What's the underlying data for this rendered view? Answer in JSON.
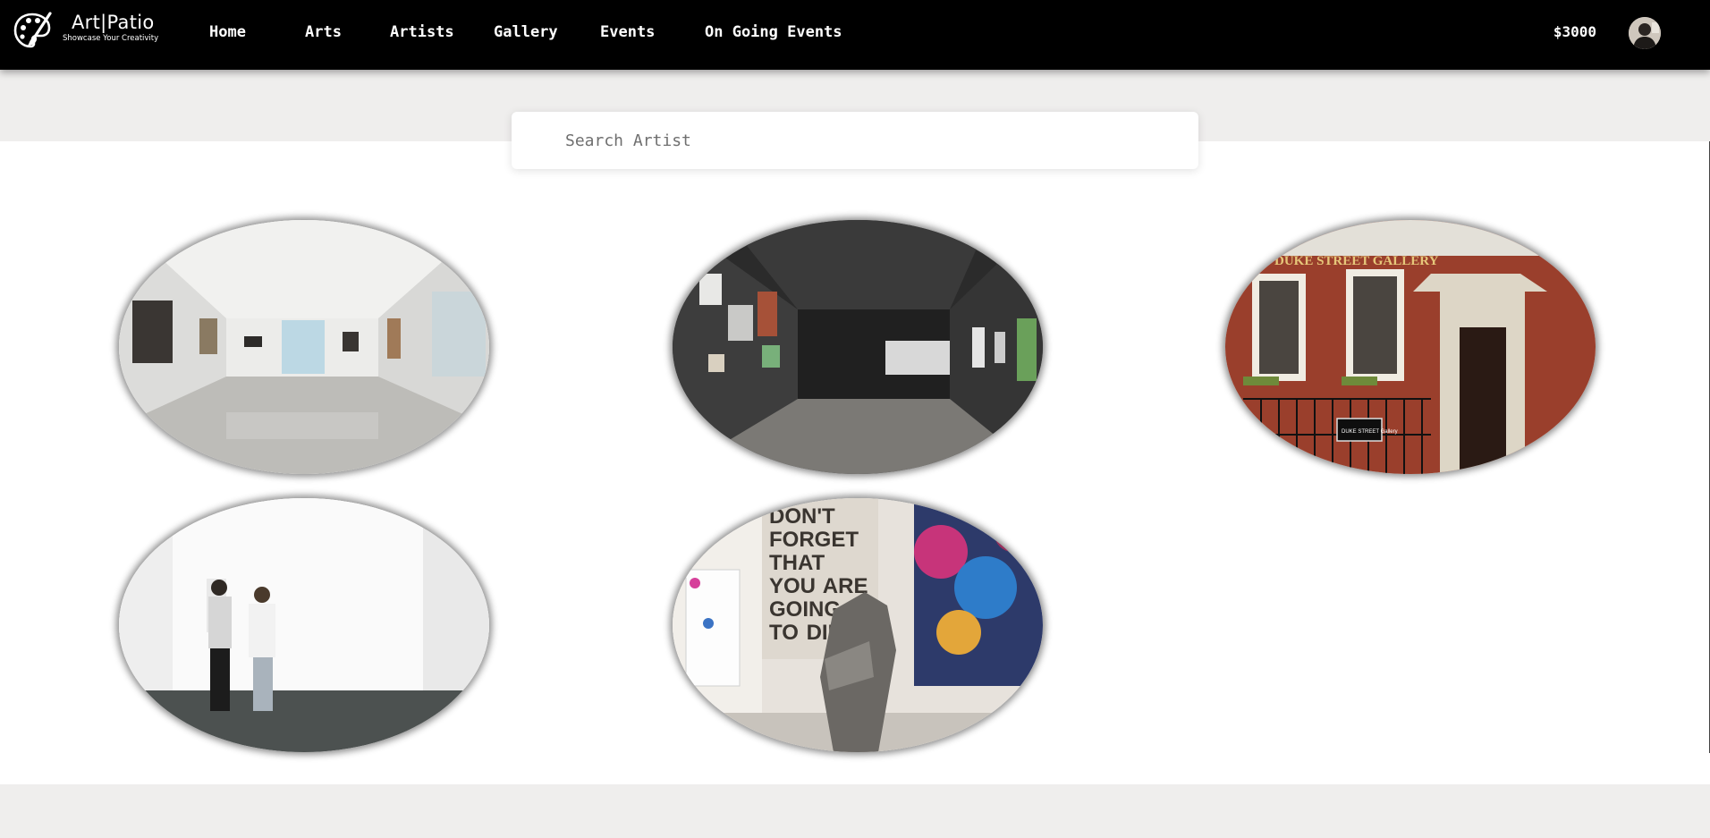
{
  "brand": {
    "title": "Art|Patio",
    "tagline": "Showcase Your Creativity",
    "logo_icon": "palette-brush-icon"
  },
  "nav": [
    {
      "label": "Home"
    },
    {
      "label": "Arts"
    },
    {
      "label": "Artists"
    },
    {
      "label": "Gallery"
    },
    {
      "label": "Events"
    },
    {
      "label": "On Going Events"
    }
  ],
  "account": {
    "balance": "$3000",
    "avatar_icon": "user-avatar"
  },
  "search": {
    "placeholder": "Search Artist",
    "value": ""
  },
  "gallery": {
    "items": [
      {
        "name": "white-gallery-hall"
      },
      {
        "name": "dark-gallery-corridor"
      },
      {
        "name": "duke-street-gallery-facade",
        "sign_text": "DUKE STREET GALLERY",
        "plaque_text": "DUKE STREET Gallery"
      },
      {
        "name": "couple-viewing-white-wall"
      },
      {
        "name": "art-installation-wrench",
        "wall_text": "DON'T FORGET THAT YOU ARE GOING TO DIE"
      }
    ]
  },
  "colors": {
    "navbar": "#000000",
    "page_band": "#efeeed",
    "content": "#ffffff",
    "nav_text": "#ffffff"
  }
}
